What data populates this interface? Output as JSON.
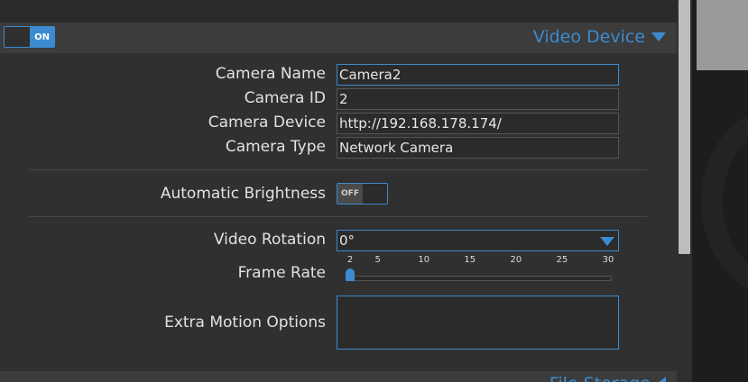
{
  "section": {
    "toggle_label": "ON",
    "title": "Video Device"
  },
  "fields": {
    "camera_name": {
      "label": "Camera Name",
      "value": "Camera2"
    },
    "camera_id": {
      "label": "Camera ID",
      "value": "2"
    },
    "camera_device": {
      "label": "Camera Device",
      "value": "http://192.168.178.174/"
    },
    "camera_type": {
      "label": "Camera Type",
      "value": "Network Camera"
    }
  },
  "brightness": {
    "label": "Automatic Brightness",
    "toggle_label": "OFF"
  },
  "rotation": {
    "label": "Video Rotation",
    "value": "0°"
  },
  "frame_rate": {
    "label": "Frame Rate",
    "ticks": [
      "2",
      "5",
      "10",
      "15",
      "20",
      "25",
      "30"
    ],
    "value": 2,
    "min": 2,
    "max": 30
  },
  "extra_motion": {
    "label": "Extra Motion Options",
    "value": ""
  },
  "next_section": {
    "title": "File Storage"
  },
  "colors": {
    "accent": "#3c8bd0",
    "panel_bg": "#303030",
    "header_bg": "#3c3c3c"
  },
  "icons": {
    "section_expanded": "chevron-down-icon",
    "section_collapsed": "chevron-left-icon",
    "select_dropdown": "chevron-down-icon"
  }
}
